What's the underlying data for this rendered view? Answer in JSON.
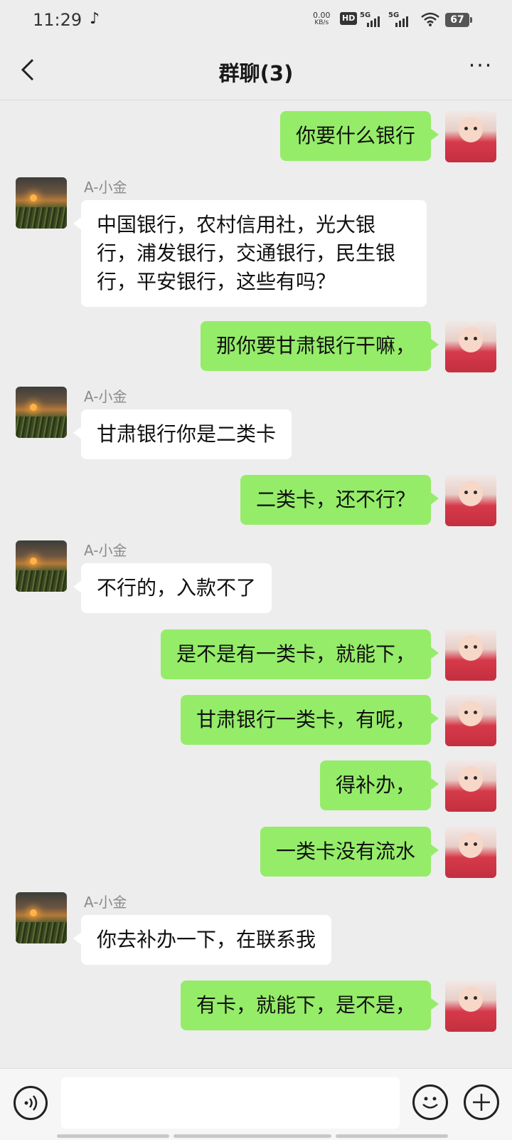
{
  "status_bar": {
    "time": "11:29",
    "net_speed_value": "0.00",
    "net_speed_unit": "KB/s",
    "hd_label": "HD",
    "sim1_label": "5G",
    "sim2_label": "5G",
    "battery_level": "67",
    "icons": [
      "tiktok-icon",
      "hd-icon",
      "signal-icon",
      "signal-icon",
      "wifi-icon",
      "battery-icon"
    ]
  },
  "header": {
    "title": "群聊(3)",
    "back_icon": "chevron-left-icon",
    "more_icon": "more-dots-icon",
    "more_label": "···"
  },
  "messages": [
    {
      "side": "out",
      "text": "你要什么银行"
    },
    {
      "side": "in",
      "sender": "A-小金",
      "text": "中国银行，农村信用社，光大银行，浦发银行，交通银行，民生银行，平安银行，这些有吗？"
    },
    {
      "side": "out",
      "text": "那你要甘肃银行干嘛，"
    },
    {
      "side": "in",
      "sender": "A-小金",
      "text": "甘肃银行你是二类卡"
    },
    {
      "side": "out",
      "text": "二类卡，还不行？"
    },
    {
      "side": "in",
      "sender": "A-小金",
      "text": "不行的，入款不了"
    },
    {
      "side": "out",
      "text": "是不是有一类卡，就能下，"
    },
    {
      "side": "out",
      "text": "甘肃银行一类卡，有呢，"
    },
    {
      "side": "out",
      "text": "得补办，"
    },
    {
      "side": "out",
      "text": "一类卡没有流水"
    },
    {
      "side": "in",
      "sender": "A-小金",
      "text": "你去补办一下，在联系我"
    },
    {
      "side": "out",
      "text": "有卡，就能下，是不是，"
    }
  ],
  "input_bar": {
    "value": "",
    "icons": [
      "voice-icon",
      "emoji-icon",
      "plus-icon"
    ]
  },
  "colors": {
    "outgoing_bubble": "#95ec69",
    "incoming_bubble": "#ffffff",
    "background": "#ededed"
  }
}
